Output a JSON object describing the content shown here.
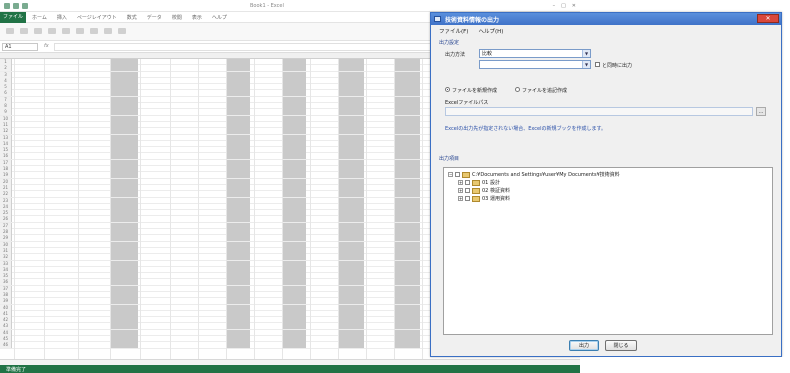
{
  "excel": {
    "title": "Book1 - Excel",
    "file_tab": "ファイル",
    "menu": [
      "ホーム",
      "挿入",
      "ページレイアウト",
      "数式",
      "データ",
      "校閲",
      "表示",
      "ヘルプ"
    ],
    "namebox": "A1",
    "fx": "fx",
    "status": "準備完了",
    "row_numbers": [
      "1",
      "2",
      "3",
      "4",
      "5",
      "6",
      "7",
      "8",
      "9",
      "10",
      "11",
      "12",
      "13",
      "14",
      "15",
      "16",
      "17",
      "18",
      "19",
      "20",
      "21",
      "22",
      "23",
      "24",
      "25",
      "26",
      "27",
      "28",
      "29",
      "30",
      "31",
      "32",
      "33",
      "34",
      "35",
      "36",
      "37",
      "38",
      "39",
      "40",
      "41",
      "42",
      "43",
      "44",
      "45",
      "46"
    ]
  },
  "dialog": {
    "title": "技術資料情報の出力",
    "close_label": "✕",
    "menu": [
      "ファイル(F)",
      "ヘルプ(H)"
    ],
    "output_group": "出力設定",
    "output_kind_label": "出力方法",
    "output_kind_value": "比較",
    "second_combo_value": "",
    "include_subfolders": "と同時に出力",
    "radio_new": "ファイルを新規作成",
    "radio_existing": "ファイルを追記作成",
    "excel_file_label": "Excelファイルパス",
    "excel_path_value": "",
    "note": "Excelの出力先が指定されない場合、Excelの新規ブックを作成します。",
    "tree_group": "出力項目",
    "tree": [
      {
        "label": "C:¥Documents and Settings¥user¥My Documents¥技術資料",
        "level": 0
      },
      {
        "label": "01 設計",
        "level": 1
      },
      {
        "label": "02 検証資料",
        "level": 1
      },
      {
        "label": "03 運用資料",
        "level": 1
      }
    ],
    "ok_label": "出力",
    "cancel_label": "閉じる"
  },
  "colors": {
    "excel_green": "#217346",
    "dialog_title_blue": "#3f72c8",
    "close_red": "#d9473a"
  }
}
